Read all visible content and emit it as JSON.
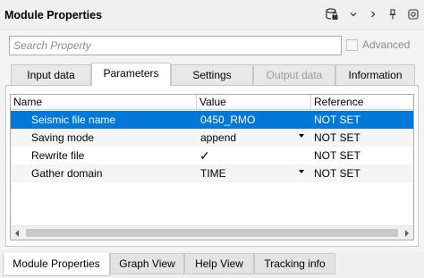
{
  "window": {
    "title": "Module Properties",
    "toolbar_icons": [
      "database-lock-icon",
      "chevron-down-icon",
      "chevron-right-icon",
      "pin-icon",
      "settings-icon"
    ]
  },
  "search": {
    "placeholder": "Search Property",
    "value": ""
  },
  "advanced": {
    "label": "Advanced",
    "checked": false
  },
  "tabs": [
    {
      "label": "Input data",
      "active": false,
      "disabled": false
    },
    {
      "label": "Parameters",
      "active": true,
      "disabled": false
    },
    {
      "label": "Settings",
      "active": false,
      "disabled": false
    },
    {
      "label": "Output data",
      "active": false,
      "disabled": true
    },
    {
      "label": "Information",
      "active": false,
      "disabled": false
    }
  ],
  "table": {
    "columns": [
      "Name",
      "Value",
      "Reference"
    ],
    "rows": [
      {
        "name": "Seismic file name",
        "value": "0450_RMO",
        "reference": "NOT SET",
        "selected": true,
        "kind": "text"
      },
      {
        "name": "Saving mode",
        "value": "append",
        "reference": "NOT SET",
        "selected": false,
        "kind": "dropdown"
      },
      {
        "name": "Rewrite file",
        "value": "✓",
        "reference": "NOT SET",
        "selected": false,
        "kind": "checkbox",
        "checked": true
      },
      {
        "name": "Gather domain",
        "value": "TIME",
        "reference": "NOT SET",
        "selected": false,
        "kind": "dropdown"
      }
    ]
  },
  "bottom_tabs": [
    {
      "label": "Module Properties",
      "active": true
    },
    {
      "label": "Graph View",
      "active": false
    },
    {
      "label": "Help View",
      "active": false
    },
    {
      "label": "Tracking info",
      "active": false
    }
  ],
  "colors": {
    "selection": "#0078d7",
    "disabled_text": "#9a9a9a"
  }
}
